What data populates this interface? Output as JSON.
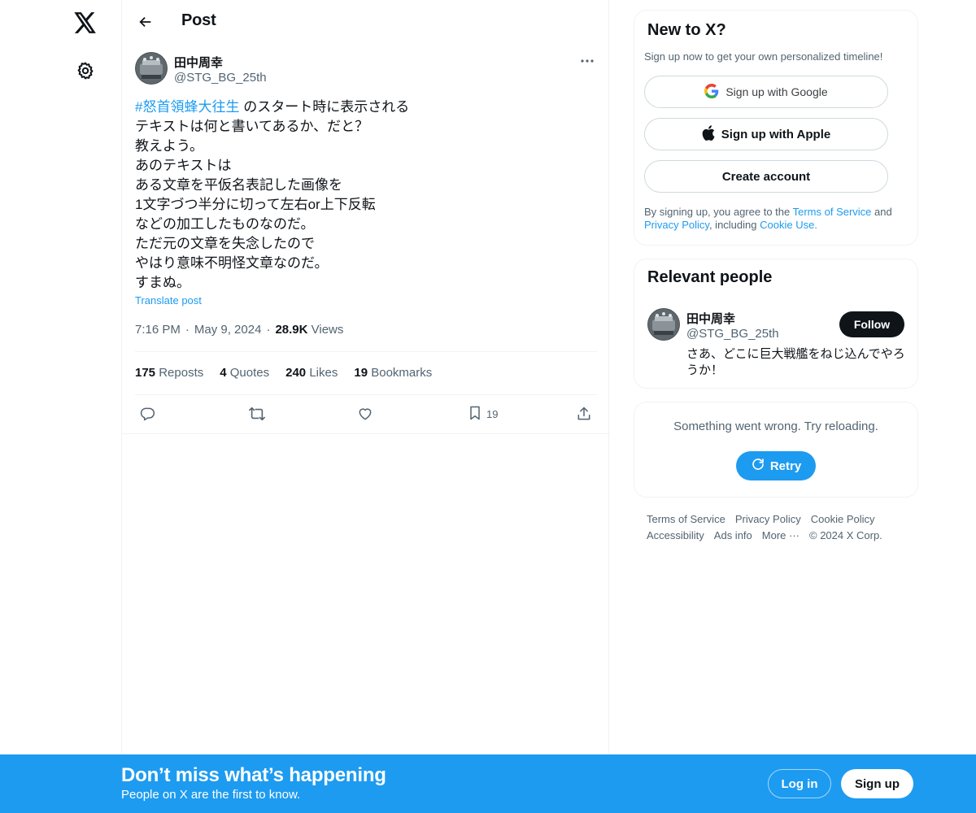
{
  "nav": {
    "logo_icon": "x-logo-icon",
    "settings_icon": "gear-icon"
  },
  "header": {
    "title": "Post",
    "back_icon": "arrow-left-icon"
  },
  "post": {
    "author_name": "田中周幸",
    "author_handle": "@STG_BG_25th",
    "hashtag": "#怒首領蜂大往生",
    "text_after_hashtag": " のスタート時に表示される\nテキストは何と書いてあるか、だと？\n教えよう。\nあのテキストは\nある文章を平仮名表記した画像を\n1文字づつ半分に切って左右or上下反転\nなどの加工したものなのだ。\nただ元の文章を失念したので\nやはり意味不明怪文章なのだ。\nすまぬ。",
    "translate_label": "Translate post",
    "time": "7:16 PM",
    "date": "May 9, 2024",
    "views_count": "28.9K",
    "views_label": "Views",
    "separator": "·",
    "stats": {
      "reposts_count": "175",
      "reposts_label": "Reposts",
      "quotes_count": "4",
      "quotes_label": "Quotes",
      "likes_count": "240",
      "likes_label": "Likes",
      "bookmarks_count": "19",
      "bookmarks_label": "Bookmarks"
    },
    "actions": {
      "bookmark_count": "19"
    }
  },
  "signup_card": {
    "title": "New to X?",
    "subtitle": "Sign up now to get your own personalized timeline!",
    "google_label": "Sign up with Google",
    "apple_label": "Sign up with Apple",
    "create_label": "Create account",
    "legal_prefix": "By signing up, you agree to the ",
    "terms_link": "Terms of Service",
    "legal_and": " and",
    "privacy_link": "Privacy Policy",
    "legal_including": ", including ",
    "cookie_link": "Cookie Use."
  },
  "relevant": {
    "title": "Relevant people",
    "name": "田中周幸",
    "handle": "@STG_BG_25th",
    "follow_label": "Follow",
    "bio": "さあ、どこに巨大戦艦をねじ込んでやろうか！"
  },
  "error_card": {
    "message": "Something went wrong. Try reloading.",
    "retry_label": "Retry"
  },
  "footer": {
    "terms": "Terms of Service",
    "privacy": "Privacy Policy",
    "cookie": "Cookie Policy",
    "accessibility": "Accessibility",
    "ads": "Ads info",
    "more": "More ···",
    "copyright": "© 2024 X Corp."
  },
  "bottom_bar": {
    "title": "Don’t miss what’s happening",
    "subtitle": "People on X are the first to know.",
    "login_label": "Log in",
    "signup_label": "Sign up"
  },
  "colors": {
    "accent": "#1d9bf0",
    "text": "#0f1419",
    "muted": "#536471",
    "border": "#eff3f4"
  }
}
